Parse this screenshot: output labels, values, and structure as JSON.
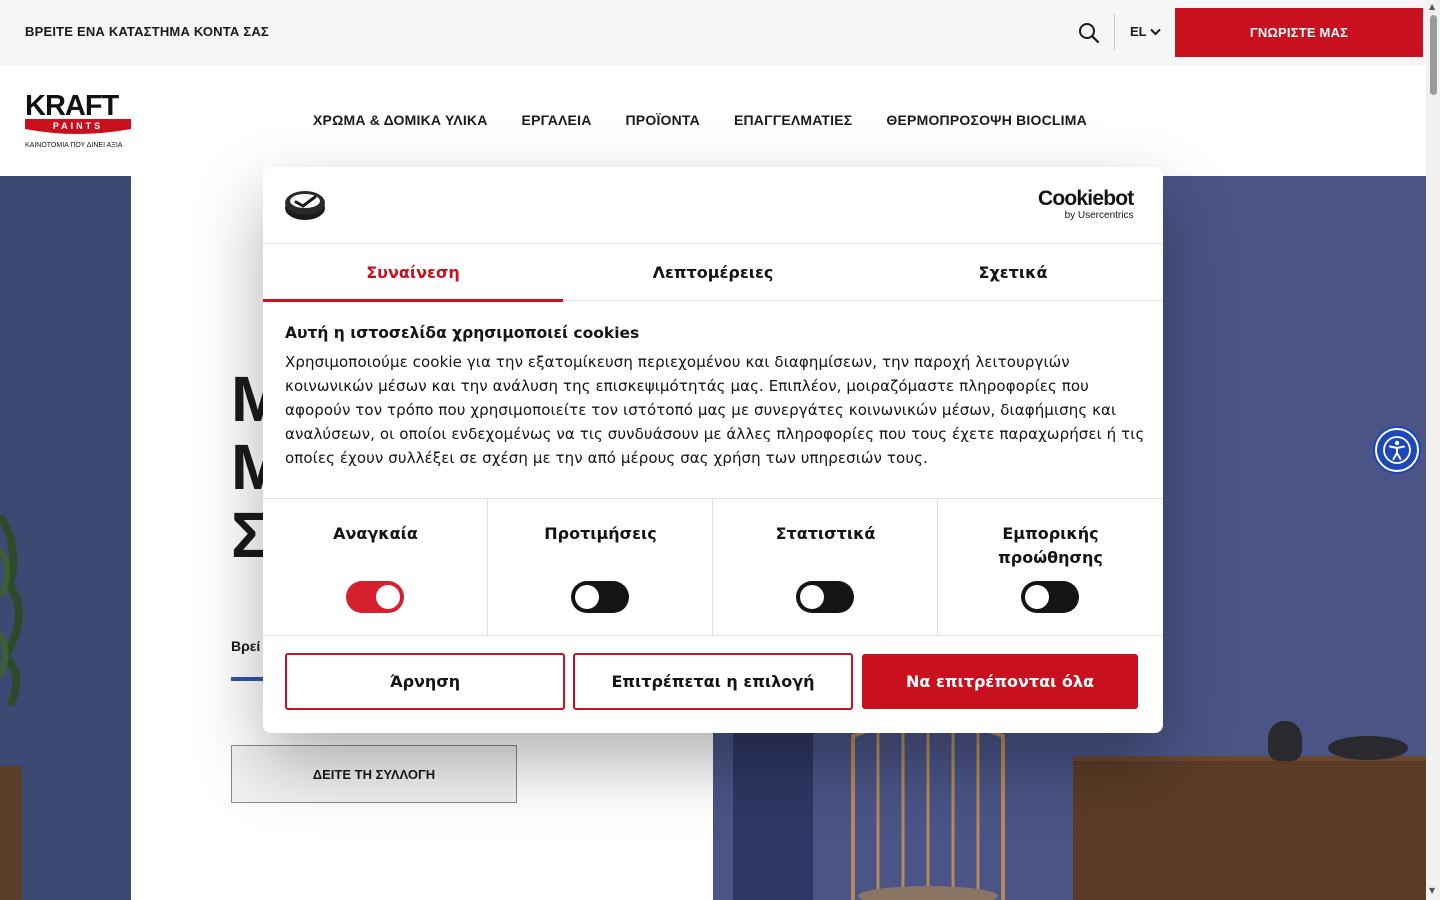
{
  "topbar": {
    "store_link": "ΒΡΕΙΤΕ ΕΝΑ ΚΑΤΑΣΤΗΜΑ ΚΟΝΤΑ ΣΑΣ",
    "language": "EL",
    "cta_label": "ΓΝΩΡΙΣΤΕ ΜΑΣ",
    "search_icon": "search-icon"
  },
  "logo": {
    "word": "KRAFT",
    "paints": "PAINTS",
    "tagline": "ΚΑΙΝΟΤΟΜΙΑ ΠΟΥ ΔΙΝΕΙ ΑΞΙΑ"
  },
  "nav": {
    "items": [
      "ΧΡΩΜΑ & ΔΟΜΙΚΑ ΥΛΙΚΑ",
      "ΕΡΓΑΛΕΙΑ",
      "ΠΡΟΪΟΝΤΑ",
      "ΕΠΑΓΓΕΛΜΑΤΙΕΣ",
      "ΘΕΡΜΟΠΡΟΣΟΨΗ BIOCLIMA"
    ]
  },
  "hero": {
    "title_visible_lines": [
      "Μ",
      "Μ",
      "Σ"
    ],
    "subtitle_visible": "Βρεί",
    "button_label": "ΔΕΙΤΕ ΤΗ ΣΥΛΛΟΓΗ"
  },
  "cookie_dialog": {
    "brand": "Cookiebot",
    "brand_by": "by Usercentrics",
    "tabs": [
      {
        "label": "Συναίνεση",
        "active": true
      },
      {
        "label": "Λεπτομέρειες",
        "active": false
      },
      {
        "label": "Σχετικά",
        "active": false
      }
    ],
    "title": "Αυτή η ιστοσελίδα χρησιμοποιεί cookies",
    "text": "Χρησιμοποιούμε cookie για την εξατομίκευση περιεχομένου και διαφημίσεων, την παροχή λειτουργιών κοινωνικών μέσων και την ανάλυση της επισκεψιμότητάς μας. Επιπλέον, μοιραζόμαστε πληροφορίες που αφορούν τον τρόπο που χρησιμοποιείτε τον ιστότοπό μας με συνεργάτες κοινωνικών μέσων, διαφήμισης και αναλύσεων, οι οποίοι ενδεχομένως να τις συνδυάσουν με άλλες πληροφορίες που τους έχετε παραχωρήσει ή τις οποίες έχουν συλλέξει σε σχέση με την από μέρους σας χρήση των υπηρεσιών τους.",
    "toggles": [
      {
        "label": "Αναγκαία",
        "on": true
      },
      {
        "label": "Προτιμήσεις",
        "on": false
      },
      {
        "label": "Στατιστικά",
        "on": false
      },
      {
        "label": "Εμπορικής προώθησης",
        "on": false
      }
    ],
    "buttons": {
      "deny": "Άρνηση",
      "allow_selection": "Επιτρέπεται η επιλογή",
      "allow_all": "Να επιτρέπονται όλα"
    }
  },
  "colors": {
    "brand_red": "#c8101e",
    "hero_blue": "#4a5486",
    "accessibility_blue": "#1e48b8"
  },
  "accessibility_icon": "accessibility-icon"
}
